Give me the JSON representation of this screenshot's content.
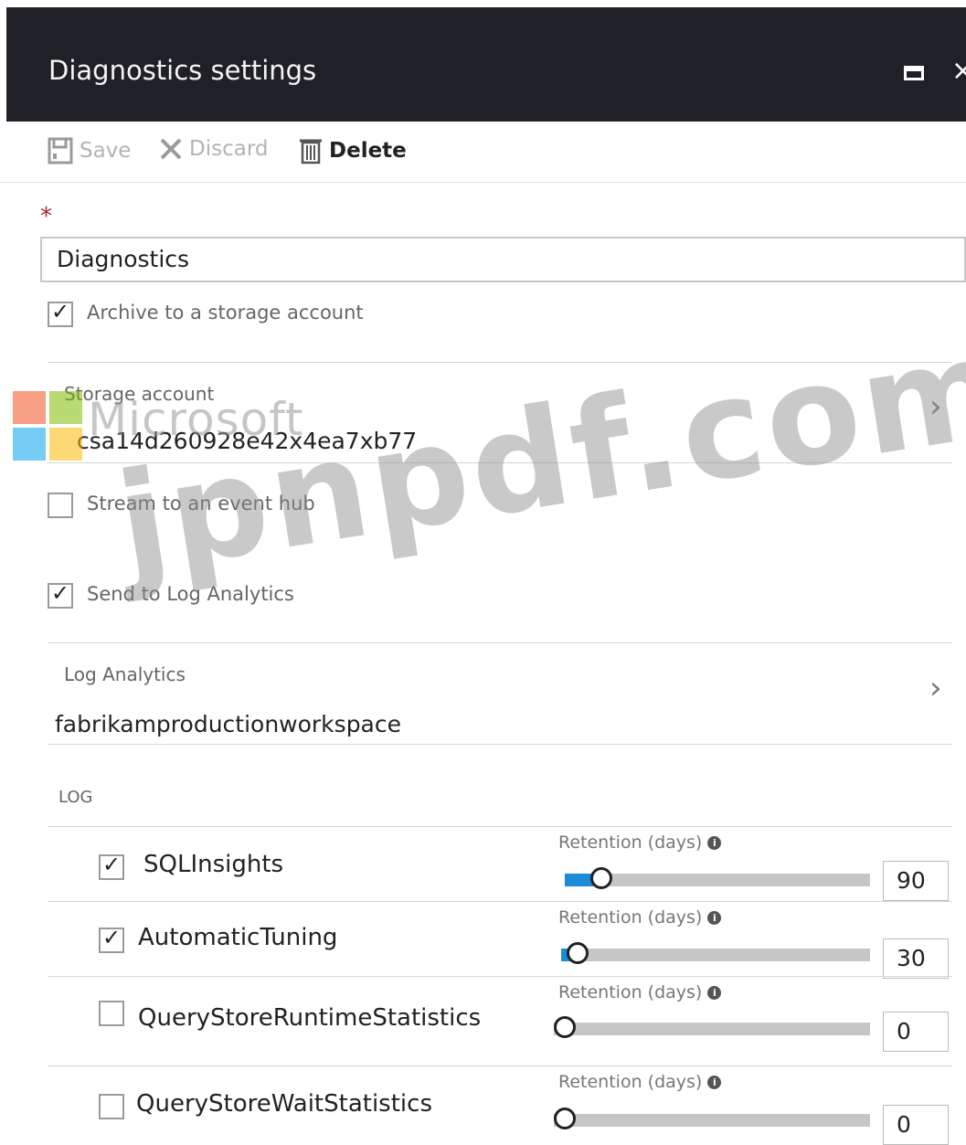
{
  "window": {
    "title": "Diagnostics settings"
  },
  "toolbar": {
    "save_label": "Save",
    "discard_label": "Discard",
    "delete_label": "Delete"
  },
  "form": {
    "required_marker": "*",
    "name_value": "Diagnostics",
    "archive": {
      "label": "Archive to a storage account",
      "checked": true
    },
    "storage": {
      "label": "Storage account",
      "value": "csa14d260928e42x4ea7xb77"
    },
    "event_hub": {
      "label": "Stream to an event hub",
      "checked": false
    },
    "log_analytics_toggle": {
      "label": "Send to Log Analytics",
      "checked": true
    },
    "log_analytics": {
      "label": "Log Analytics",
      "value": "fabrikamproductionworkspace"
    }
  },
  "log": {
    "header": "LOG",
    "retention_label": "Retention (days)",
    "rows": [
      {
        "name": "SQLInsights",
        "checked": true,
        "retention": "90"
      },
      {
        "name": "AutomaticTuning",
        "checked": true,
        "retention": "30"
      },
      {
        "name": "QueryStoreRuntimeStatistics",
        "checked": false,
        "retention": "0"
      },
      {
        "name": "QueryStoreWaitStatistics",
        "checked": false,
        "retention": "0"
      }
    ]
  },
  "watermark": {
    "brand": "Microsoft",
    "site": "jpnpdf.com"
  },
  "icons": [
    "save-icon",
    "discard-icon",
    "delete-icon",
    "maximize-icon",
    "close-icon",
    "chevron-right-icon",
    "info-icon",
    "checkmark-icon"
  ],
  "colors": {
    "titlebar": "#1f2126",
    "slider_fill": "#1b8bd8",
    "required": "#a4262c"
  }
}
